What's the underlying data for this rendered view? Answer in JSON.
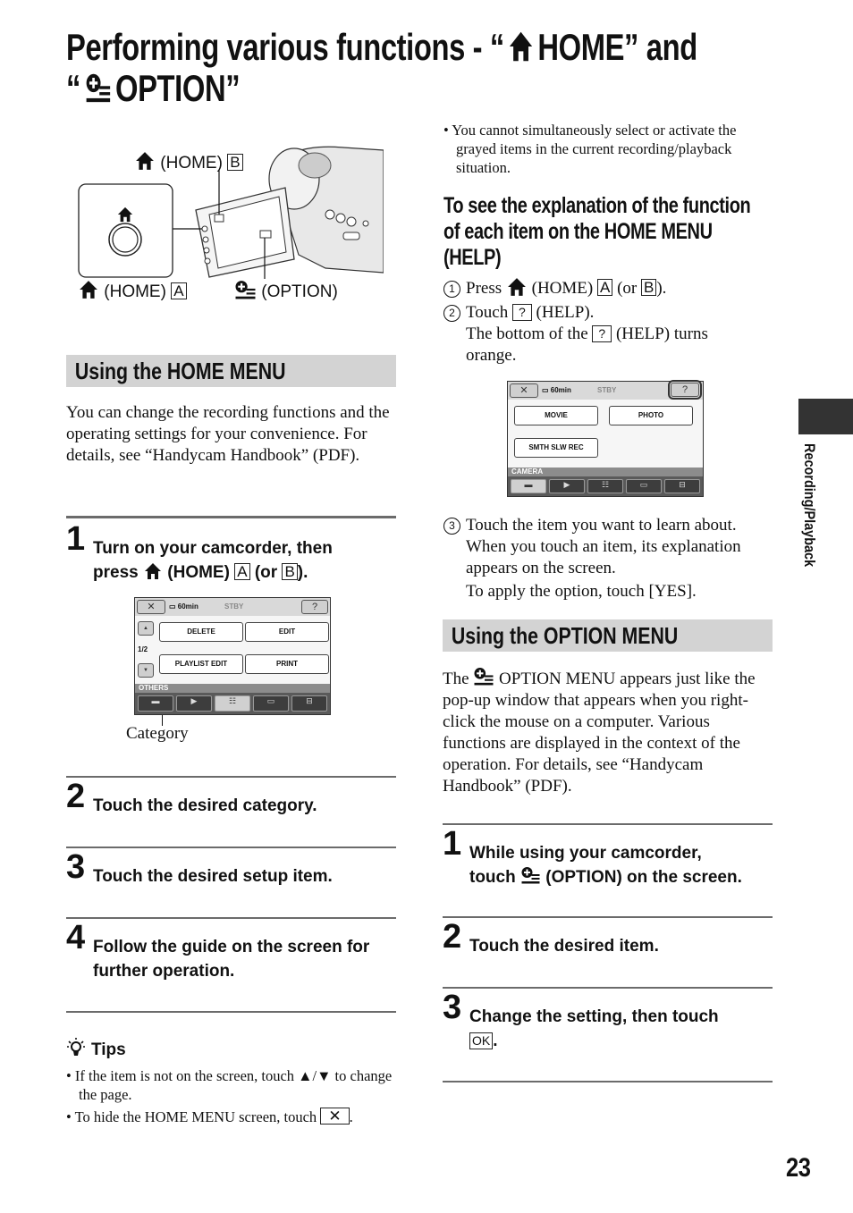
{
  "title": {
    "line1_pre": "Performing various functions - “",
    "line1_home": "HOME” and",
    "line2_pre": "“",
    "line2_option": "OPTION”",
    "home_icon": "home-icon",
    "option_icon": "option-icon"
  },
  "illustration": {
    "label_home_b": "(HOME)",
    "label_home_b_box": "B",
    "label_home_a": "(HOME)",
    "label_home_a_box": "A",
    "label_option": "(OPTION)"
  },
  "home_menu": {
    "heading": "Using the HOME MENU",
    "intro": "You can change the recording functions and the operating settings for your convenience. For details, see “Handycam Handbook” (PDF).",
    "steps": [
      {
        "num": "1",
        "line1": "Turn on your camcorder, then",
        "line2_pre": "press",
        "line2_home": "(HOME)",
        "box_a": "A",
        "or": "(or",
        "box_b": "B",
        "end": ")."
      },
      {
        "num": "2",
        "text": "Touch the desired category."
      },
      {
        "num": "3",
        "text": "Touch the desired setup item."
      },
      {
        "num": "4",
        "line1": "Follow the guide on the screen for",
        "line2": "further operation."
      }
    ],
    "screen": {
      "close": "✕",
      "battery": "60min",
      "status": "STBY",
      "help": "?",
      "page": "1/2",
      "up": "▲",
      "down": "▼",
      "items": [
        "DELETE",
        "EDIT",
        "PLAYLIST EDIT",
        "PRINT"
      ],
      "category": "OTHERS",
      "tabs": [
        "camera",
        "playback",
        "others",
        "memory",
        "settings"
      ],
      "selected_tab": 2
    },
    "category_caption": "Category",
    "tips": {
      "heading": "Tips",
      "items": [
        "If the item is not on the screen, touch ▲/▼ to change the page.",
        "To hide the HOME MENU screen, touch"
      ],
      "close_box": "✕"
    }
  },
  "help": {
    "note": "You cannot simultaneously select or activate the grayed items in the current recording/playback situation.",
    "heading_lines": [
      "To see the explanation of the function",
      "of each item on the HOME MENU",
      "(HELP)"
    ],
    "step1": {
      "num": "1",
      "pre": "Press",
      "home": "(HOME)",
      "box_a": "A",
      "or": "(or",
      "box_b": "B",
      "end": ")."
    },
    "step2": {
      "num": "2",
      "pre": "Touch",
      "box": "?",
      "post": "(HELP).",
      "sub_pre": "The bottom of the",
      "sub_box": "?",
      "sub_post": "(HELP) turns",
      "sub_line2": "orange."
    },
    "screen": {
      "close": "✕",
      "battery": "60min",
      "status": "STBY",
      "help": "?",
      "items": [
        "MOVIE",
        "PHOTO",
        "SMTH SLW REC"
      ],
      "category": "CAMERA",
      "selected_tab": 0
    },
    "step3": {
      "num": "3",
      "lines": [
        "Touch the item you want to learn about.",
        "When you touch an item, its explanation",
        "appears on the screen."
      ],
      "apply": "To apply the option, touch [YES]."
    }
  },
  "option_menu": {
    "heading": "Using the OPTION MENU",
    "intro_pre": "The",
    "intro_post": "OPTION MENU appears just like the pop-up window that appears when you right-click the mouse on a computer. Various functions are displayed in the context of the operation. For details, see “Handycam Handbook” (PDF).",
    "steps": [
      {
        "num": "1",
        "line1": "While using your camcorder,",
        "line2_pre": "touch",
        "line2_post": "(OPTION) on the screen."
      },
      {
        "num": "2",
        "text": "Touch the desired item."
      },
      {
        "num": "3",
        "line1": "Change the setting, then touch",
        "box": "OK",
        "end": "."
      }
    ]
  },
  "side_tab": {
    "label": "Recording/Playback"
  },
  "page_number": "23"
}
